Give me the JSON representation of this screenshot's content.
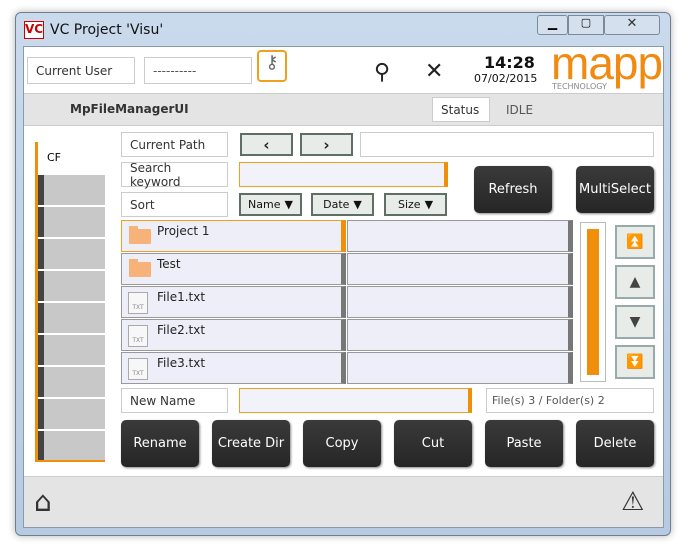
{
  "window": {
    "title": "VC Project 'Visu'",
    "logo": "VC"
  },
  "header": {
    "user_label": "Current User",
    "user_value": "----------",
    "time": "14:28",
    "date": "07/02/2015",
    "brand": "mapp",
    "brand_sub": "TECHNOLOGY",
    "icons": [
      "key-icon",
      "search-icon",
      "tools-icon"
    ]
  },
  "subheader": {
    "title": "MpFileManagerUI",
    "status_label": "Status",
    "status_value": "IDLE"
  },
  "sidebar": {
    "items": [
      {
        "label": "CF"
      }
    ]
  },
  "main": {
    "current_path_label": "Current Path",
    "current_path_value": "",
    "search_label": "Search keyword",
    "search_value": "",
    "sort_label": "Sort",
    "sort_buttons": [
      "Name",
      "Date",
      "Size"
    ],
    "refresh": "Refresh",
    "multiselect": "MultiSelect",
    "files": [
      {
        "name": "Project 1",
        "type": "folder"
      },
      {
        "name": "Test",
        "type": "folder"
      },
      {
        "name": "File1.txt",
        "type": "txt"
      },
      {
        "name": "File2.txt",
        "type": "txt"
      },
      {
        "name": "File3.txt",
        "type": "txt"
      }
    ],
    "txt_icon_label": "TXT",
    "new_name_label": "New Name",
    "new_name_value": "",
    "info": "File(s) 3 / Folder(s) 2",
    "actions": [
      "Rename",
      "Create Dir",
      "Copy",
      "Cut",
      "Paste",
      "Delete"
    ]
  },
  "colors": {
    "accent": "#f0900a",
    "dark_button": "#2e2e2e"
  }
}
